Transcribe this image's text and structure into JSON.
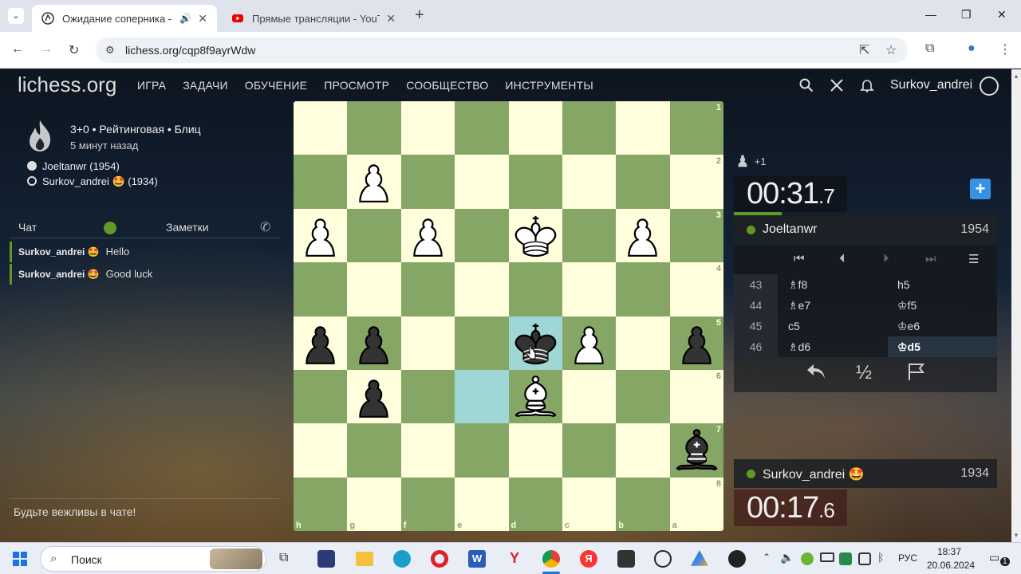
{
  "browser": {
    "tabs": [
      {
        "title": "Ожидание соперника - Иг",
        "active": true
      },
      {
        "title": "Прямые трансляции - YouTube",
        "active": false
      }
    ],
    "url": "lichess.org/cqp8f9ayrWdw"
  },
  "site": {
    "logo": "lichess.org",
    "nav": [
      "ИГРА",
      "ЗАДАЧИ",
      "ОБУЧЕНИЕ",
      "ПРОСМОТР",
      "СООБЩЕСТВО",
      "ИНСТРУМЕНТЫ"
    ],
    "username": "Surkov_andrei"
  },
  "game": {
    "title": "3+0 • Рейтинговая • Блиц",
    "time_ago": "5 минут назад",
    "players": [
      {
        "name": "Joeltanwr (1954)",
        "color": "white"
      },
      {
        "name": "Surkov_andrei 🤩 (1934)",
        "color": "black"
      }
    ]
  },
  "chat": {
    "tab_chat": "Чат",
    "tab_notes": "Заметки",
    "messages": [
      {
        "author": "Surkov_andrei 🤩",
        "text": "Hello"
      },
      {
        "author": "Surkov_andrei 🤩",
        "text": "Good luck"
      }
    ],
    "placeholder": "Будьте вежливы в чате!"
  },
  "board": {
    "ranks": [
      "1",
      "2",
      "3",
      "4",
      "5",
      "6",
      "7",
      "8"
    ],
    "files": [
      "h",
      "g",
      "f",
      "e",
      "d",
      "c",
      "b",
      "a"
    ],
    "highlights": [
      [
        4,
        4
      ],
      [
        3,
        5
      ]
    ],
    "pieces": [
      {
        "type": "pawn",
        "color": "white",
        "col": 1,
        "row": 1
      },
      {
        "type": "pawn",
        "color": "white",
        "col": 0,
        "row": 2
      },
      {
        "type": "pawn",
        "color": "white",
        "col": 2,
        "row": 2
      },
      {
        "type": "king",
        "color": "white",
        "col": 4,
        "row": 2
      },
      {
        "type": "pawn",
        "color": "white",
        "col": 6,
        "row": 2
      },
      {
        "type": "pawn",
        "color": "black",
        "col": 0,
        "row": 4
      },
      {
        "type": "pawn",
        "color": "black",
        "col": 1,
        "row": 4
      },
      {
        "type": "king",
        "color": "black",
        "col": 4,
        "row": 4
      },
      {
        "type": "pawn",
        "color": "white",
        "col": 5,
        "row": 4
      },
      {
        "type": "pawn",
        "color": "black",
        "col": 7,
        "row": 4
      },
      {
        "type": "pawn",
        "color": "black",
        "col": 1,
        "row": 5
      },
      {
        "type": "bishop",
        "color": "white",
        "col": 4,
        "row": 5
      },
      {
        "type": "bishop",
        "color": "black",
        "col": 7,
        "row": 6
      }
    ]
  },
  "right_panel": {
    "material": "+1",
    "opponent_clock": {
      "main": "00:31",
      "tenths": ".7"
    },
    "opponent": {
      "name": "Joeltanwr",
      "rating": "1954"
    },
    "moves": [
      {
        "num": "43",
        "white": "♗f8",
        "black": "h5"
      },
      {
        "num": "44",
        "white": "♗e7",
        "black": "♔f5"
      },
      {
        "num": "45",
        "white": "c5",
        "black": "♔e6"
      },
      {
        "num": "46",
        "white": "♗d6",
        "black": "♔d5",
        "current": true
      }
    ],
    "draw_label": "½",
    "player": {
      "name": "Surkov_andrei 🤩",
      "rating": "1934"
    },
    "player_clock": {
      "main": "00:17",
      "tenths": ".6"
    }
  },
  "taskbar": {
    "search": "Поиск",
    "lang": "РУС",
    "time": "18:37",
    "date": "20.06.2024",
    "notifications": "1"
  }
}
